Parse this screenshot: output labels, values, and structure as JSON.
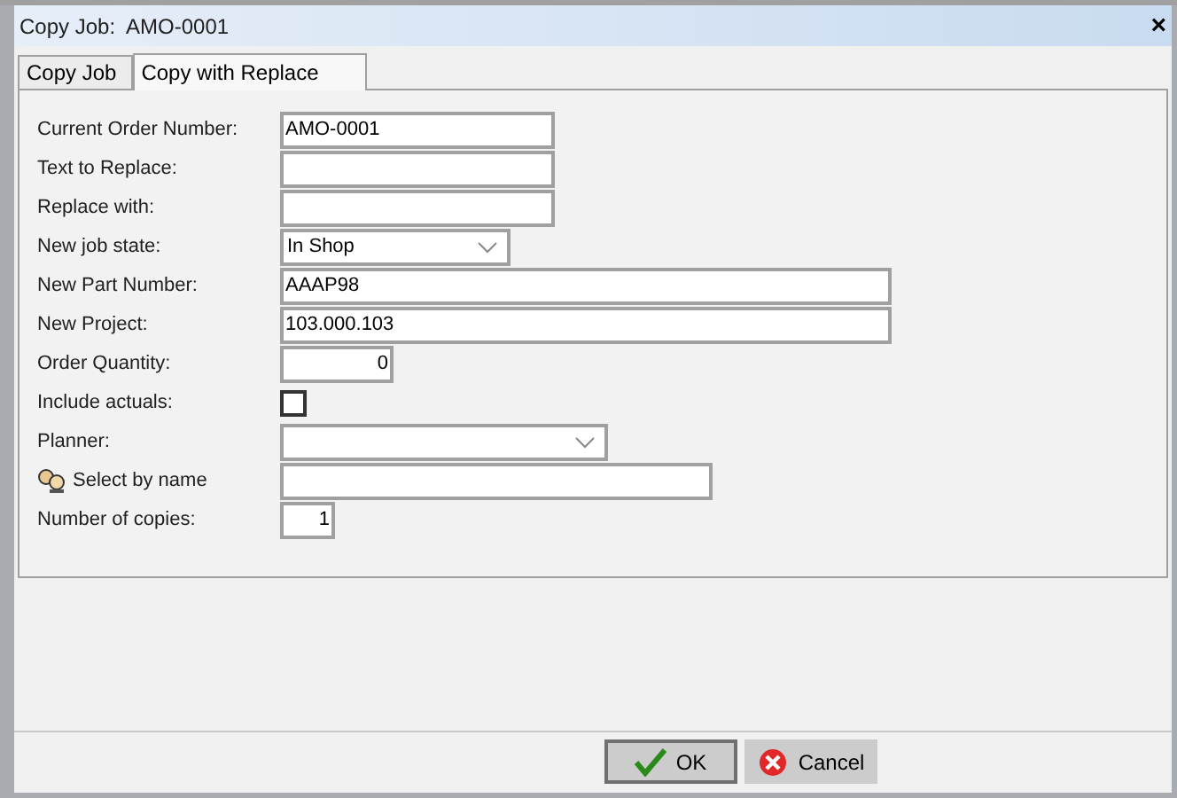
{
  "window": {
    "title": "Copy Job:  AMO-0001",
    "close": "×"
  },
  "tabs": [
    {
      "label": "Copy Job",
      "selected": false
    },
    {
      "label": "Copy with Replace",
      "selected": true
    }
  ],
  "fields": [
    {
      "label": "Current Order Number:",
      "kind": "text",
      "value": "AMO-0001"
    },
    {
      "label": "Text to Replace:",
      "kind": "text"
    },
    {
      "label": "Replace with:",
      "kind": "text"
    },
    {
      "label": "New job state:",
      "kind": "select",
      "value": "In Shop"
    },
    {
      "label": "New Part Number:",
      "kind": "text",
      "value": "AAAP98"
    },
    {
      "label": "New Project:",
      "kind": "text",
      "value": "103.000.103"
    },
    {
      "label": "Order Quantity:",
      "kind": "number",
      "value": "0"
    },
    {
      "label": "Include actuals:",
      "kind": "checkbox",
      "checked": false
    },
    {
      "label": "Planner:",
      "kind": "select"
    },
    {
      "label": "Select by name",
      "kind": "lookup"
    },
    {
      "label": "Number of copies:",
      "kind": "number",
      "value": "1"
    }
  ],
  "buttons": [
    {
      "label": "OK",
      "kind": "ok"
    },
    {
      "label": "Cancel",
      "kind": "cancel"
    }
  ]
}
